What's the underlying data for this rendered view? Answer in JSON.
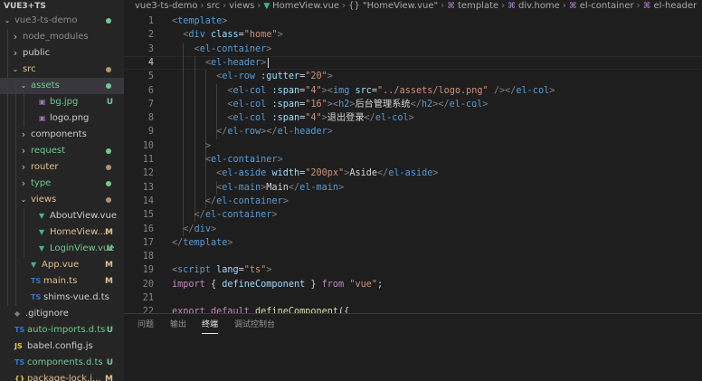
{
  "explorer": {
    "root": "VUE3+TS",
    "items": [
      {
        "label": "vue3-ts-demo",
        "chevron": "open",
        "icon": "",
        "color": "gray",
        "dot": "#73c991",
        "deco": ""
      },
      {
        "label": "node_modules",
        "chevron": "closed",
        "icon": "",
        "color": "gray",
        "dot": "",
        "deco": ""
      },
      {
        "label": "public",
        "chevron": "closed",
        "icon": "",
        "color": "normal",
        "dot": "",
        "deco": ""
      },
      {
        "label": "src",
        "chevron": "open",
        "icon": "",
        "color": "mod",
        "dot": "#b2936d",
        "deco": ""
      },
      {
        "label": "assets",
        "chevron": "open",
        "icon": "",
        "color": "green",
        "dot": "#73c991",
        "deco": ""
      },
      {
        "label": "bg.jpg",
        "chevron": "",
        "icon": "▣",
        "iconColor": "#a074c4",
        "color": "green",
        "dot": "",
        "deco": "U"
      },
      {
        "label": "logo.png",
        "chevron": "",
        "icon": "▣",
        "iconColor": "#a074c4",
        "color": "normal",
        "dot": "",
        "deco": ""
      },
      {
        "label": "components",
        "chevron": "closed",
        "icon": "",
        "color": "normal",
        "dot": "",
        "deco": ""
      },
      {
        "label": "request",
        "chevron": "closed",
        "icon": "",
        "color": "green",
        "dot": "#73c991",
        "deco": ""
      },
      {
        "label": "router",
        "chevron": "closed",
        "icon": "",
        "color": "mod",
        "dot": "#b2936d",
        "deco": ""
      },
      {
        "label": "type",
        "chevron": "closed",
        "icon": "",
        "color": "green",
        "dot": "#73c991",
        "deco": ""
      },
      {
        "label": "views",
        "chevron": "open",
        "icon": "",
        "color": "mod",
        "dot": "#b2936d",
        "deco": ""
      },
      {
        "label": "AboutView.vue",
        "chevron": "",
        "icon": "▼",
        "iconColor": "#41b883",
        "color": "normal",
        "dot": "",
        "deco": ""
      },
      {
        "label": "HomeView....",
        "chevron": "",
        "icon": "▼",
        "iconColor": "#41b883",
        "color": "mod",
        "dot": "",
        "deco": "M"
      },
      {
        "label": "LoginView.vue",
        "chevron": "",
        "icon": "▼",
        "iconColor": "#41b883",
        "color": "green",
        "dot": "",
        "deco": "U"
      },
      {
        "label": "App.vue",
        "chevron": "",
        "icon": "▼",
        "iconColor": "#41b883",
        "color": "mod",
        "dot": "",
        "deco": "M"
      },
      {
        "label": "main.ts",
        "chevron": "",
        "icon": "TS",
        "iconColor": "#3178c6",
        "color": "mod",
        "dot": "",
        "deco": "M"
      },
      {
        "label": "shims-vue.d.ts",
        "chevron": "",
        "icon": "TS",
        "iconColor": "#3178c6",
        "color": "normal",
        "dot": "",
        "deco": ""
      },
      {
        "label": ".gitignore",
        "chevron": "",
        "icon": "◆",
        "iconColor": "#7f7f7f",
        "color": "normal",
        "dot": "",
        "deco": ""
      },
      {
        "label": "auto-imports.d.ts",
        "chevron": "",
        "icon": "TS",
        "iconColor": "#3178c6",
        "color": "green",
        "dot": "",
        "deco": "U"
      },
      {
        "label": "babel.config.js",
        "chevron": "",
        "icon": "JS",
        "iconColor": "#e6c84c",
        "color": "normal",
        "dot": "",
        "deco": ""
      },
      {
        "label": "components.d.ts",
        "chevron": "",
        "icon": "TS",
        "iconColor": "#3178c6",
        "color": "green",
        "dot": "",
        "deco": "U"
      },
      {
        "label": "package-lock.j...",
        "chevron": "",
        "icon": "{}",
        "iconColor": "#e6c84c",
        "color": "mod",
        "dot": "",
        "deco": "M"
      }
    ]
  },
  "breadcrumb": [
    "vue3-ts-demo",
    "src",
    "views",
    "HomeView.vue",
    "{} \"HomeView.vue\"",
    "template",
    "div.home",
    "el-container",
    "el-header"
  ],
  "editor": {
    "current_line": 4,
    "lines": [
      {
        "n": "1",
        "t": [
          [
            "t-br",
            "<"
          ],
          [
            "t-tag",
            "template"
          ],
          [
            "t-br",
            ">"
          ]
        ]
      },
      {
        "n": "2",
        "t": [
          [
            "t-txt",
            "  "
          ],
          [
            "t-br",
            "<"
          ],
          [
            "t-tag",
            "div"
          ],
          [
            "t-txt",
            " "
          ],
          [
            "t-attr",
            "class"
          ],
          [
            "t-txt",
            "="
          ],
          [
            "t-str",
            "\"home\""
          ],
          [
            "t-br",
            ">"
          ]
        ]
      },
      {
        "n": "3",
        "t": [
          [
            "t-txt",
            "    "
          ],
          [
            "t-br",
            "<"
          ],
          [
            "t-tag",
            "el-container"
          ],
          [
            "t-br",
            ">"
          ]
        ]
      },
      {
        "n": "4",
        "t": [
          [
            "t-txt",
            "      "
          ],
          [
            "t-br",
            "<"
          ],
          [
            "t-tag",
            "el-header"
          ],
          [
            "t-br",
            ">"
          ]
        ]
      },
      {
        "n": "5",
        "t": [
          [
            "t-txt",
            "        "
          ],
          [
            "t-br",
            "<"
          ],
          [
            "t-tag",
            "el-row"
          ],
          [
            "t-txt",
            " "
          ],
          [
            "t-attr",
            ":gutter"
          ],
          [
            "t-txt",
            "="
          ],
          [
            "t-str",
            "\"20\""
          ],
          [
            "t-br",
            ">"
          ]
        ]
      },
      {
        "n": "6",
        "t": [
          [
            "t-txt",
            "          "
          ],
          [
            "t-br",
            "<"
          ],
          [
            "t-tag",
            "el-col"
          ],
          [
            "t-txt",
            " "
          ],
          [
            "t-attr",
            ":span"
          ],
          [
            "t-txt",
            "="
          ],
          [
            "t-str",
            "\"4\""
          ],
          [
            "t-br",
            ">"
          ],
          [
            "t-br",
            "<"
          ],
          [
            "t-tag",
            "img"
          ],
          [
            "t-txt",
            " "
          ],
          [
            "t-attr",
            "src"
          ],
          [
            "t-txt",
            "="
          ],
          [
            "t-str",
            "\"../assets/logo.png\""
          ],
          [
            "t-txt",
            " "
          ],
          [
            "t-br",
            "/>"
          ],
          [
            "t-br",
            "</"
          ],
          [
            "t-tag",
            "el-col"
          ],
          [
            "t-br",
            ">"
          ]
        ]
      },
      {
        "n": "7",
        "t": [
          [
            "t-txt",
            "          "
          ],
          [
            "t-br",
            "<"
          ],
          [
            "t-tag",
            "el-col"
          ],
          [
            "t-txt",
            " "
          ],
          [
            "t-attr",
            ":span"
          ],
          [
            "t-txt",
            "="
          ],
          [
            "t-str",
            "\"16\""
          ],
          [
            "t-br",
            ">"
          ],
          [
            "t-br",
            "<"
          ],
          [
            "t-tag",
            "h2"
          ],
          [
            "t-br",
            ">"
          ],
          [
            "t-txt",
            "后台管理系统"
          ],
          [
            "t-br",
            "</"
          ],
          [
            "t-tag",
            "h2"
          ],
          [
            "t-br",
            ">"
          ],
          [
            "t-br",
            "</"
          ],
          [
            "t-tag",
            "el-col"
          ],
          [
            "t-br",
            ">"
          ]
        ]
      },
      {
        "n": "8",
        "t": [
          [
            "t-txt",
            "          "
          ],
          [
            "t-br",
            "<"
          ],
          [
            "t-tag",
            "el-col"
          ],
          [
            "t-txt",
            " "
          ],
          [
            "t-attr",
            ":span"
          ],
          [
            "t-txt",
            "="
          ],
          [
            "t-str",
            "\"4\""
          ],
          [
            "t-br",
            ">"
          ],
          [
            "t-txt",
            "退出登录"
          ],
          [
            "t-br",
            "</"
          ],
          [
            "t-tag",
            "el-col"
          ],
          [
            "t-br",
            ">"
          ]
        ]
      },
      {
        "n": "9",
        "t": [
          [
            "t-txt",
            "        "
          ],
          [
            "t-br",
            "</"
          ],
          [
            "t-tag",
            "el-row"
          ],
          [
            "t-br",
            ">"
          ],
          [
            "t-br",
            "</"
          ],
          [
            "t-tag",
            "el-header"
          ],
          [
            "t-br",
            ">"
          ]
        ]
      },
      {
        "n": "10",
        "t": [
          [
            "t-txt",
            "      "
          ],
          [
            "t-br",
            ">"
          ]
        ]
      },
      {
        "n": "11",
        "t": [
          [
            "t-txt",
            "      "
          ],
          [
            "t-br",
            "<"
          ],
          [
            "t-tag",
            "el-container"
          ],
          [
            "t-br",
            ">"
          ]
        ]
      },
      {
        "n": "12",
        "t": [
          [
            "t-txt",
            "        "
          ],
          [
            "t-br",
            "<"
          ],
          [
            "t-tag",
            "el-aside"
          ],
          [
            "t-txt",
            " "
          ],
          [
            "t-attr",
            "width"
          ],
          [
            "t-txt",
            "="
          ],
          [
            "t-str",
            "\"200px\""
          ],
          [
            "t-br",
            ">"
          ],
          [
            "t-txt",
            "Aside"
          ],
          [
            "t-br",
            "</"
          ],
          [
            "t-tag",
            "el-aside"
          ],
          [
            "t-br",
            ">"
          ]
        ]
      },
      {
        "n": "13",
        "t": [
          [
            "t-txt",
            "        "
          ],
          [
            "t-br",
            "<"
          ],
          [
            "t-tag",
            "el-main"
          ],
          [
            "t-br",
            ">"
          ],
          [
            "t-txt",
            "Main"
          ],
          [
            "t-br",
            "</"
          ],
          [
            "t-tag",
            "el-main"
          ],
          [
            "t-br",
            ">"
          ]
        ]
      },
      {
        "n": "14",
        "t": [
          [
            "t-txt",
            "      "
          ],
          [
            "t-br",
            "</"
          ],
          [
            "t-tag",
            "el-container"
          ],
          [
            "t-br",
            ">"
          ]
        ]
      },
      {
        "n": "15",
        "t": [
          [
            "t-txt",
            "    "
          ],
          [
            "t-br",
            "</"
          ],
          [
            "t-tag",
            "el-container"
          ],
          [
            "t-br",
            ">"
          ]
        ]
      },
      {
        "n": "16",
        "t": [
          [
            "t-txt",
            "  "
          ],
          [
            "t-br",
            "</"
          ],
          [
            "t-tag",
            "div"
          ],
          [
            "t-br",
            ">"
          ]
        ]
      },
      {
        "n": "17",
        "t": [
          [
            "t-br",
            "</"
          ],
          [
            "t-tag",
            "template"
          ],
          [
            "t-br",
            ">"
          ]
        ]
      },
      {
        "n": "18",
        "t": []
      },
      {
        "n": "19",
        "t": [
          [
            "t-br",
            "<"
          ],
          [
            "t-tag",
            "script"
          ],
          [
            "t-txt",
            " "
          ],
          [
            "t-attr",
            "lang"
          ],
          [
            "t-txt",
            "="
          ],
          [
            "t-str",
            "\"ts\""
          ],
          [
            "t-br",
            ">"
          ]
        ]
      },
      {
        "n": "20",
        "t": [
          [
            "t-kw",
            "import"
          ],
          [
            "t-txt",
            " { "
          ],
          [
            "t-var",
            "defineComponent"
          ],
          [
            "t-txt",
            " } "
          ],
          [
            "t-kw",
            "from"
          ],
          [
            "t-txt",
            " "
          ],
          [
            "t-str",
            "\"vue\""
          ],
          [
            "t-txt",
            ";"
          ]
        ]
      },
      {
        "n": "21",
        "t": []
      },
      {
        "n": "22",
        "t": [
          [
            "t-kw",
            "export"
          ],
          [
            "t-txt",
            " "
          ],
          [
            "t-kw",
            "default"
          ],
          [
            "t-txt",
            " "
          ],
          [
            "t-fn",
            "defineComponent"
          ],
          [
            "t-txt",
            "({"
          ]
        ]
      }
    ]
  },
  "panel": {
    "tabs": [
      "问题",
      "输出",
      "终端",
      "调试控制台"
    ],
    "active": 2
  }
}
